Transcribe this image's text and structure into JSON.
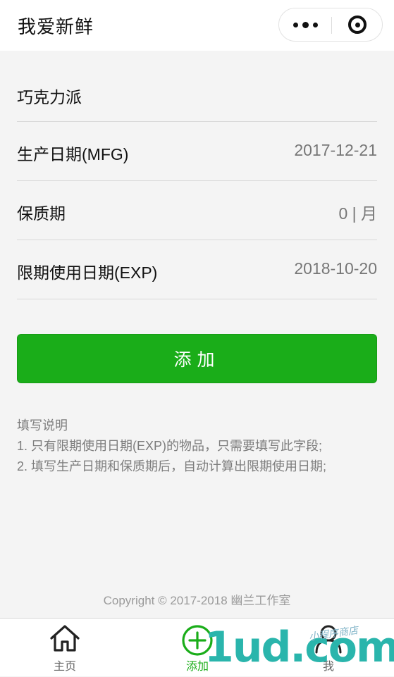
{
  "nav": {
    "title": "我爱新鲜",
    "more_icon": "more-dots-icon",
    "close_icon": "target-close-icon"
  },
  "form": {
    "rows": [
      {
        "label": "巧克力派",
        "value": ""
      },
      {
        "label": "生产日期(MFG)",
        "value": "2017-12-21"
      },
      {
        "label": "保质期",
        "value": "0 | 月"
      },
      {
        "label": "限期使用日期(EXP)",
        "value": "2018-10-20"
      }
    ]
  },
  "add_button": {
    "label": "添加"
  },
  "notes": {
    "title": "填写说明",
    "items": [
      "1. 只有限期使用日期(EXP)的物品，只需要填写此字段;",
      "2. 填写生产日期和保质期后，自动计算出限期使用日期;"
    ]
  },
  "footer": {
    "copyright": "Copyright © 2017-2018 幽兰工作室"
  },
  "tabbar": {
    "tabs": [
      {
        "label": "主页",
        "icon": "home-icon",
        "active": false
      },
      {
        "label": "添加",
        "icon": "add-circle-icon",
        "active": true
      },
      {
        "label": "我",
        "icon": "user-icon",
        "active": false
      }
    ]
  },
  "watermark": {
    "text": "1ud.com",
    "small": "小程序商店"
  },
  "colors": {
    "accent": "#1aad19",
    "background": "#f4f4f4"
  }
}
